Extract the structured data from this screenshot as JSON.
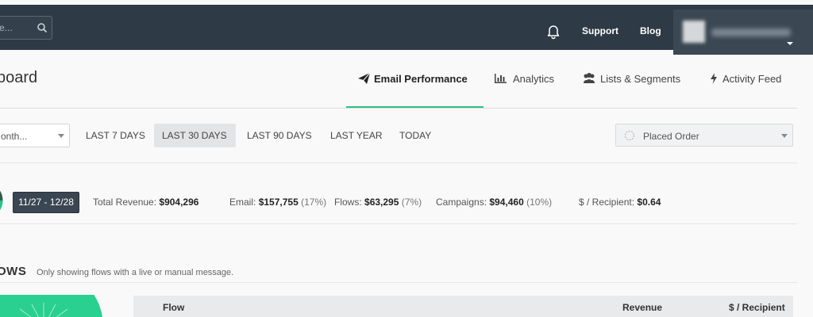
{
  "topbar": {
    "search_placeholder_visible": "e...",
    "support_label": "Support",
    "blog_label": "Blog"
  },
  "header": {
    "title_fragment": "board",
    "tabs": [
      {
        "label": "Email Performance",
        "icon": "paper-plane-icon",
        "active": true
      },
      {
        "label": "Analytics",
        "icon": "bar-chart-icon",
        "active": false
      },
      {
        "label": "Lists & Segments",
        "icon": "users-icon",
        "active": false
      },
      {
        "label": "Activity Feed",
        "icon": "bolt-icon",
        "active": false
      }
    ]
  },
  "filters": {
    "period_select_value": "onth...",
    "ranges": [
      {
        "label": "LAST 7 DAYS",
        "active": false
      },
      {
        "label": "LAST 30 DAYS",
        "active": true
      },
      {
        "label": "LAST 90 DAYS",
        "active": false
      },
      {
        "label": "LAST YEAR",
        "active": false
      },
      {
        "label": "TODAY",
        "active": false
      }
    ],
    "metric_select_value": "Placed Order"
  },
  "summary": {
    "date_range": "11/27 - 12/28",
    "total_revenue_label": "Total Revenue:",
    "total_revenue_value": "$904,296",
    "email_label": "Email:",
    "email_value": "$157,755",
    "email_pct": "(17%)",
    "flows_label": "Flows:",
    "flows_value": "$63,295",
    "flows_pct": "(7%)",
    "campaigns_label": "Campaigns:",
    "campaigns_value": "$94,460",
    "campaigns_pct": "(10%)",
    "per_recipient_label": "$ / Recipient:",
    "per_recipient_value": "$0.64"
  },
  "flows": {
    "title_fragment": "OWS",
    "note": "Only showing flows with a live or manual message.",
    "columns": [
      "Flow",
      "Revenue",
      "$ / Recipient"
    ]
  },
  "colors": {
    "topbar": "#2e3a45",
    "accent_green": "#29c38a",
    "badge": "#3a4651"
  }
}
